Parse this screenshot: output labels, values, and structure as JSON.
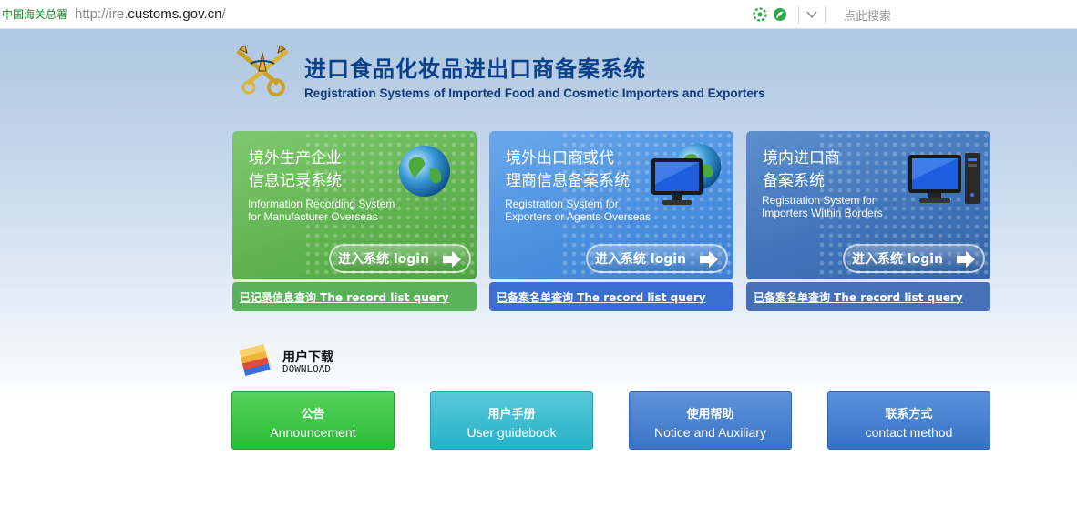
{
  "browser": {
    "site_label": "中国海关总署",
    "url_prefix": "http://ire.",
    "url_host": "customs.gov.cn",
    "url_suffix": "/",
    "search_placeholder": "点此搜索"
  },
  "header": {
    "title_cn": "进口食品化妆品进出口商备案系统",
    "title_en": "Registration Systems of Imported Food and Cosmetic Importers and Exporters"
  },
  "cards": [
    {
      "title_cn_line1": "境外生产企业",
      "title_cn_line2": "信息记录系统",
      "desc_en_line1": "Information Recording System",
      "desc_en_line2": "for Manufacturer Overseas",
      "login_label": "进入系统  login",
      "query_label": "已记录信息查询  The record list query",
      "icon": "globe-icon"
    },
    {
      "title_cn_line1": "境外出口商或代",
      "title_cn_line2": "理商信息备案系统",
      "desc_en_line1": "Registration System for",
      "desc_en_line2": "Exporters or Agents Overseas",
      "login_label": "进入系统  login",
      "query_label": "已备案名单查询  The record list query",
      "icon": "globe-monitor-icon"
    },
    {
      "title_cn_line1": "境内进口商",
      "title_cn_line2": "备案系统",
      "desc_en_line1": "Registration System for",
      "desc_en_line2": "Importers Within Borders",
      "login_label": "进入系统  login",
      "query_label": "已备案名单查询  The record list query",
      "icon": "computer-icon"
    }
  ],
  "download": {
    "title_cn": "用户下载",
    "title_en": "DOWNLOAD"
  },
  "buttons": [
    {
      "cn": "公告",
      "en": "Announcement"
    },
    {
      "cn": "用户手册",
      "en": "User guidebook"
    },
    {
      "cn": "使用帮助",
      "en": "Notice and Auxiliary"
    },
    {
      "cn": "联系方式",
      "en": "contact method"
    }
  ],
  "colors": {
    "title": "#0b3f88",
    "card_green": "#5fb24f",
    "card_light_blue": "#4a8ede",
    "card_dark_blue": "#3f72b8"
  }
}
